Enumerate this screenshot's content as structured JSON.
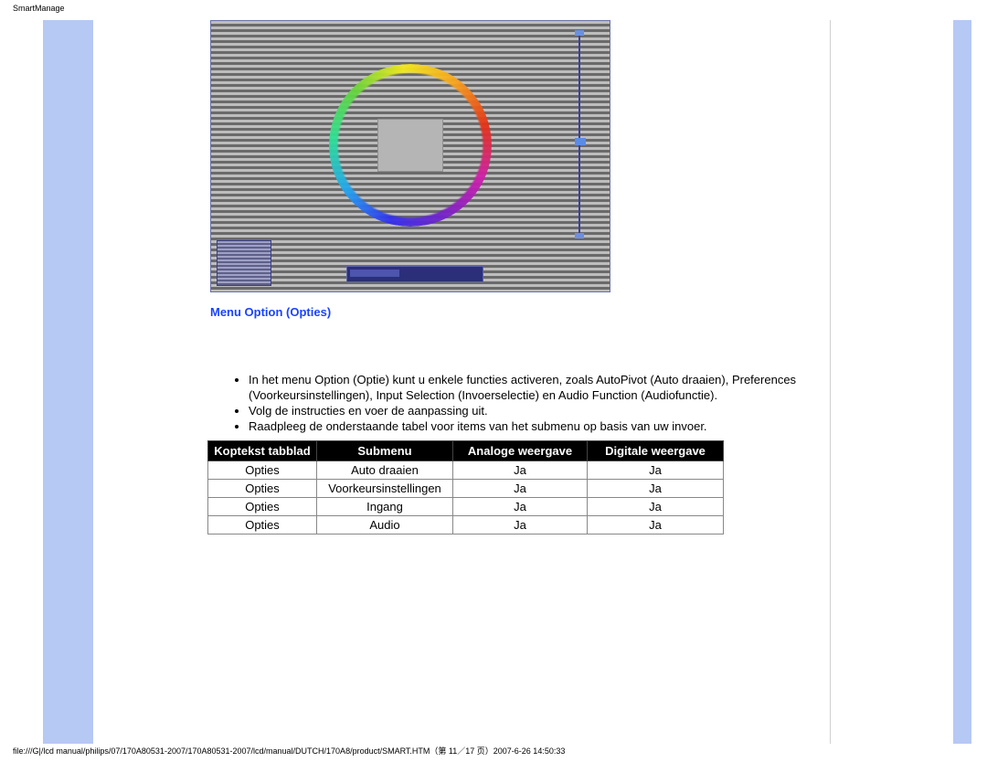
{
  "page": {
    "title": "SmartManage",
    "footer": "file:///G|/lcd manual/philips/07/170A80531-2007/170A80531-2007/lcd/manual/DUTCH/170A8/product/SMART.HTM（第 11／17 页）2007-6-26 14:50:33"
  },
  "section": {
    "heading": "Menu Option (Opties)"
  },
  "bullets": {
    "b1": "In het menu Option (Optie) kunt u enkele functies activeren, zoals AutoPivot (Auto draaien), Preferences (Voorkeursinstellingen), Input Selection (Invoerselectie) en Audio Function (Audiofunctie).",
    "b2": "Volg de instructies en voer de aanpassing uit.",
    "b3": "Raadpleeg de onderstaande tabel voor items van het submenu op basis van uw invoer."
  },
  "table": {
    "headers": {
      "c1": "Koptekst tabblad",
      "c2": "Submenu",
      "c3": "Analoge weergave",
      "c4": "Digitale weergave"
    },
    "rows": [
      {
        "c1": "Opties",
        "c2": "Auto draaien",
        "c3": "Ja",
        "c4": "Ja"
      },
      {
        "c1": "Opties",
        "c2": "Voorkeursinstellingen",
        "c3": "Ja",
        "c4": "Ja"
      },
      {
        "c1": "Opties",
        "c2": "Ingang",
        "c3": "Ja",
        "c4": "Ja"
      },
      {
        "c1": "Opties",
        "c2": "Audio",
        "c3": "Ja",
        "c4": "Ja"
      }
    ]
  }
}
